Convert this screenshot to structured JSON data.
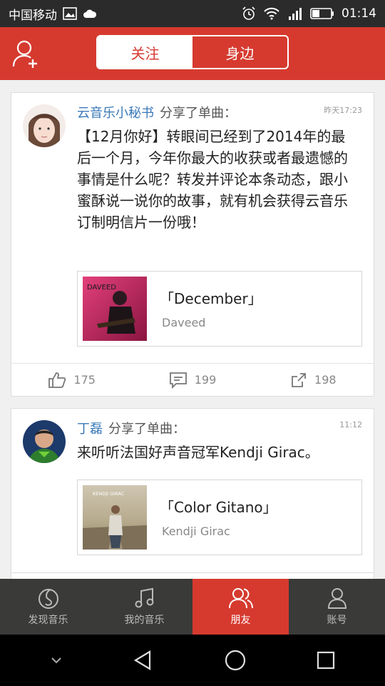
{
  "status_bar": {
    "carrier": "中国移动",
    "time": "01:14",
    "icons": [
      "image-icon",
      "cloud-icon",
      "alarm-icon",
      "wifi-icon",
      "signal-icon",
      "battery-icon"
    ]
  },
  "header": {
    "tabs": [
      {
        "label": "关注",
        "active": true
      },
      {
        "label": "身边",
        "active": false
      }
    ]
  },
  "posts": [
    {
      "user": "云音乐小秘书",
      "action": "分享了单曲：",
      "time": "昨天17:23",
      "text": "【12月你好】转眼间已经到了2014年的最后一个月，今年你最大的收获或者最遗憾的事情是什么呢？转发并评论本条动态，跟小蜜酥说一说你的故事，就有机会获得云音乐订制明信片一份哦！",
      "song": {
        "title": "「December」",
        "artist": "Daveed",
        "cover_text": "DAVEED"
      },
      "likes": "175",
      "comments": "199",
      "shares": "198"
    },
    {
      "user": "丁磊",
      "action": "分享了单曲：",
      "time": "11:12",
      "text": "来听听法国好声音冠军Kendji Girac。",
      "song": {
        "title": "「Color Gitano」",
        "artist": "Kendji Girac",
        "cover_text": "KENDJI GIRAC"
      }
    }
  ],
  "tabbar": [
    {
      "label": "发现音乐",
      "icon": "discover-icon",
      "active": false
    },
    {
      "label": "我的音乐",
      "icon": "music-note-icon",
      "active": false
    },
    {
      "label": "朋友",
      "icon": "friends-icon",
      "active": true
    },
    {
      "label": "账号",
      "icon": "account-icon",
      "active": false
    }
  ],
  "colors": {
    "brand": "#d63a2f",
    "user_link": "#3a79b8"
  }
}
